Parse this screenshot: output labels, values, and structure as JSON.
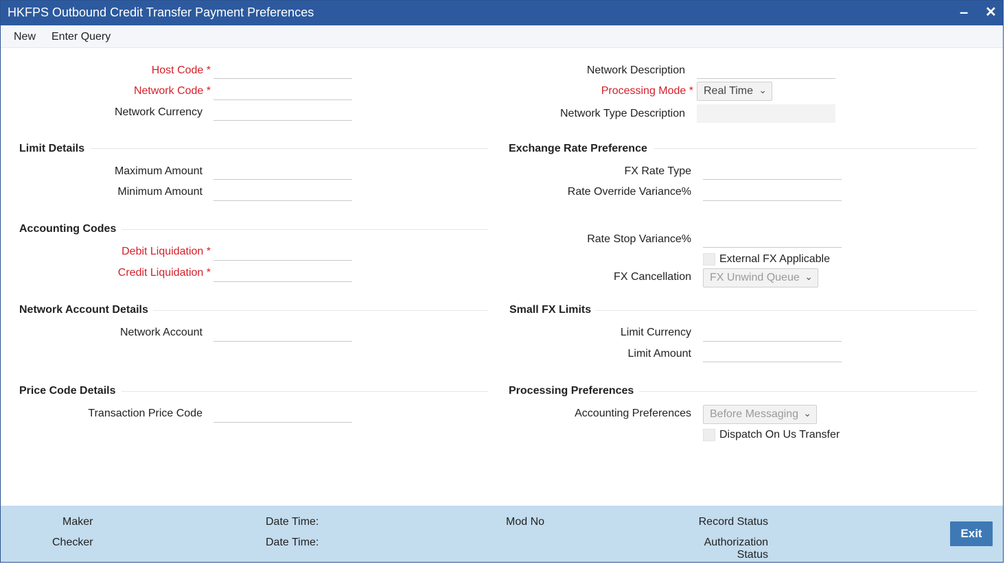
{
  "window": {
    "title": "HKFPS Outbound Credit Transfer Payment Preferences",
    "minimize_symbol": "–",
    "close_symbol": "✕"
  },
  "menu": [
    "New",
    "Enter Query"
  ],
  "required_mark": "*",
  "header": {
    "host_code": "Host Code",
    "network_code": "Network Code",
    "network_currency": "Network Currency",
    "network_description": "Network Description",
    "processing_mode": "Processing Mode",
    "processing_mode_value": "Real Time",
    "network_type_description": "Network Type Description"
  },
  "limit_details": {
    "title": "Limit Details",
    "maximum_amount": "Maximum Amount",
    "minimum_amount": "Minimum Amount"
  },
  "exchange_rate": {
    "title": "Exchange Rate Preference",
    "fx_rate_type": "FX Rate Type",
    "rate_override_variance": "Rate Override Variance%",
    "rate_stop_variance": "Rate Stop Variance%",
    "external_fx_applicable": "External FX Applicable",
    "fx_cancellation": "FX Cancellation",
    "fx_cancellation_value": "FX Unwind Queue"
  },
  "accounting_codes": {
    "title": "Accounting Codes",
    "debit_liquidation": "Debit Liquidation",
    "credit_liquidation": "Credit Liquidation"
  },
  "network_account": {
    "title": "Network Account Details",
    "network_account": "Network Account"
  },
  "small_fx": {
    "title": "Small FX Limits",
    "limit_currency": "Limit Currency",
    "limit_amount": "Limit Amount"
  },
  "price_code": {
    "title": "Price Code Details",
    "transaction_price_code": "Transaction Price Code"
  },
  "processing_prefs": {
    "title": "Processing Preferences",
    "accounting_preferences": "Accounting Preferences",
    "accounting_preferences_value": "Before Messaging",
    "dispatch_on_us_transfer": "Dispatch On Us Transfer"
  },
  "footer": {
    "maker": "Maker",
    "checker": "Checker",
    "date_time_1": "Date Time:",
    "date_time_2": "Date Time:",
    "mod_no": "Mod No",
    "record_status": "Record Status",
    "authorization_status_line1": "Authorization",
    "authorization_status_line2": "Status",
    "exit": "Exit"
  },
  "colors": {
    "titlebar": "#2d5a9e",
    "required_label": "#d4202a",
    "footer_bg": "#c3dcee",
    "exit_button": "#3e79b5"
  }
}
